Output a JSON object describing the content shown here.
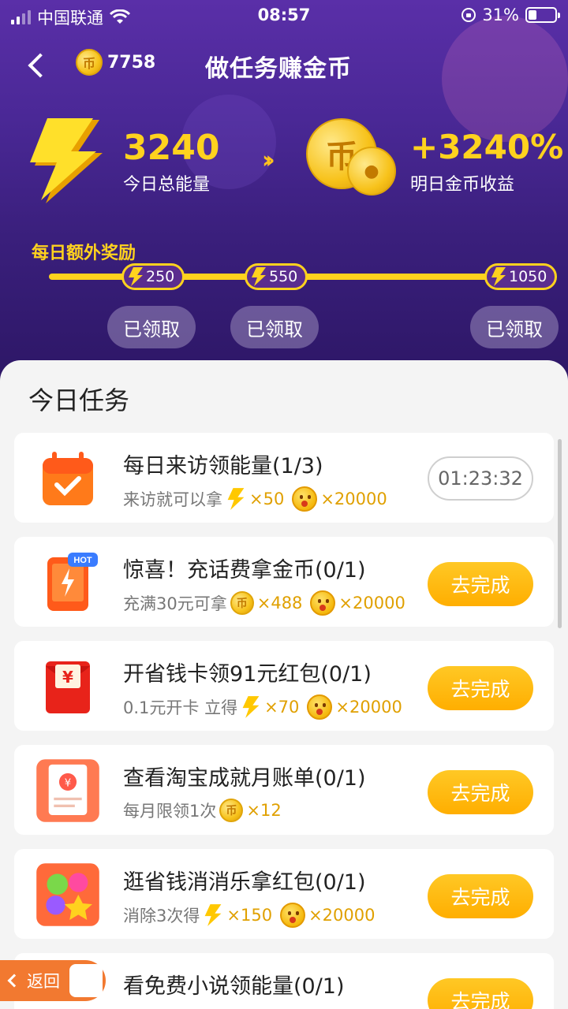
{
  "status_bar": {
    "carrier": "中国联通",
    "time": "08:57",
    "battery": "31%",
    "battery_level": 0.31
  },
  "nav": {
    "coin_balance": "7758",
    "title": "做任务赚金币"
  },
  "summary": {
    "energy_value": "3240",
    "energy_label": "今日总能量",
    "income_value": "+3240%",
    "income_label": "明日金币收益"
  },
  "bonus": {
    "title": "每日额外奖励",
    "milestones": [
      {
        "value": "250",
        "status": "已领取"
      },
      {
        "value": "550",
        "status": "已领取"
      },
      {
        "value": "1050",
        "status": "已领取"
      }
    ]
  },
  "tasks_section": {
    "title": "今日任务"
  },
  "tasks": [
    {
      "name": "每日来访领能量(1/3)",
      "desc": "来访就可以拿",
      "reward1_type": "energy",
      "reward1": "×50",
      "reward2_type": "face",
      "reward2": "×20000",
      "action": "01:23:32",
      "action_type": "timer"
    },
    {
      "name": "惊喜！充话费拿金币(0/1)",
      "desc": "充满30元可拿",
      "reward1_type": "coin",
      "reward1": "×488",
      "reward2_type": "face",
      "reward2": "×20000",
      "action": "去完成",
      "action_type": "button",
      "hot_badge": "HOT"
    },
    {
      "name": "开省钱卡领91元红包(0/1)",
      "desc": "0.1元开卡 立得",
      "reward1_type": "energy",
      "reward1": "×70",
      "reward2_type": "face",
      "reward2": "×20000",
      "action": "去完成",
      "action_type": "button"
    },
    {
      "name": "查看淘宝成就月账单(0/1)",
      "desc": "每月限领1次",
      "reward1_type": "coin",
      "reward1": "×12",
      "action": "去完成",
      "action_type": "button"
    },
    {
      "name": "逛省钱消消乐拿红包(0/1)",
      "desc": "消除3次得",
      "reward1_type": "energy",
      "reward1": "×150",
      "reward2_type": "face",
      "reward2": "×20000",
      "action": "去完成",
      "action_type": "button"
    },
    {
      "name": "看免费小说领能量(0/1)",
      "action": "去完成",
      "action_type": "button"
    }
  ],
  "float_back": {
    "label": "返回"
  },
  "colors": {
    "accent": "#ffd21e",
    "button": "#ffb400",
    "hero": "#4a2896"
  }
}
